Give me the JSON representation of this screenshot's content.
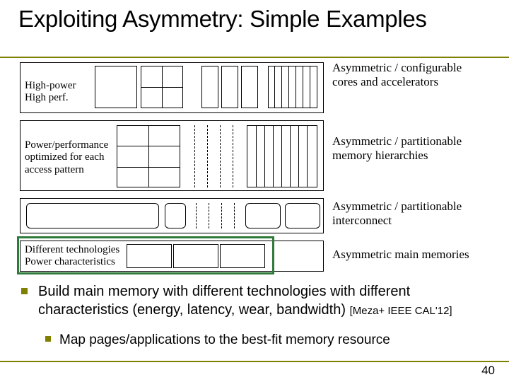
{
  "title": "Exploiting Asymmetry: Simple Examples",
  "diagram": {
    "cores": {
      "left_label": "High-power\nHigh perf.",
      "right_label": "Asymmetric / configurable cores and accelerators"
    },
    "mem": {
      "left_label": "Power/performance optimized for each access pattern",
      "right_label": "Asymmetric / partitionable memory hierarchies"
    },
    "ic": {
      "right_label": "Asymmetric / partitionable interconnect"
    },
    "main": {
      "left_label": "Different technologies\nPower characteristics",
      "right_label": "Asymmetric main memories"
    }
  },
  "bullets": {
    "b1_text": "Build main memory with different technologies with different characteristics (energy, latency, wear, bandwidth) ",
    "b1_cite": "[Meza+ IEEE CAL'12]",
    "b2_text": "Map pages/applications to the best-fit memory resource"
  },
  "page_number": "40"
}
